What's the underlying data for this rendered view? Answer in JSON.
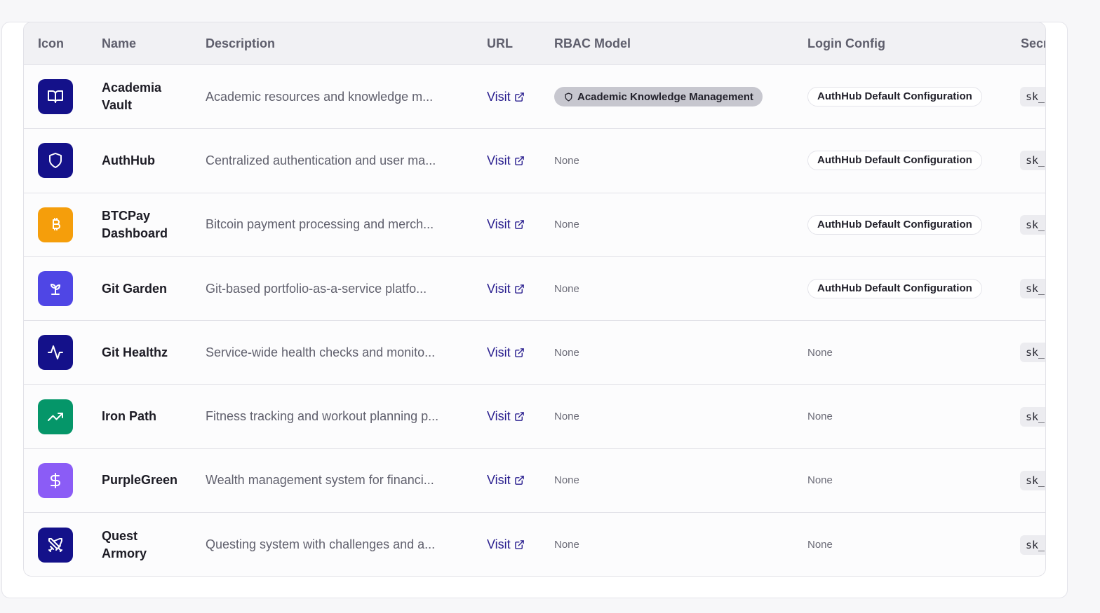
{
  "headers": {
    "icon": "Icon",
    "name": "Name",
    "description": "Description",
    "url": "URL",
    "rbac": "RBAC Model",
    "login": "Login Config",
    "secret": "Secr"
  },
  "rows": [
    {
      "icon": "book-open-icon",
      "color": "#14118a",
      "name": "Academia Vault",
      "description": "Academic resources and knowledge m...",
      "url_label": "Visit",
      "rbac": "Academic Knowledge Management",
      "login": "AuthHub Default Configuration",
      "secret": "sk_"
    },
    {
      "icon": "shield-icon",
      "color": "#14118a",
      "name": "AuthHub",
      "description": "Centralized authentication and user ma...",
      "url_label": "Visit",
      "rbac": "None",
      "login": "AuthHub Default Configuration",
      "secret": "sk_"
    },
    {
      "icon": "bitcoin-icon",
      "color": "#f59e0b",
      "name": "BTCPay Dashboard",
      "description": "Bitcoin payment processing and merch...",
      "url_label": "Visit",
      "rbac": "None",
      "login": "AuthHub Default Configuration",
      "secret": "sk_"
    },
    {
      "icon": "sprout-icon",
      "color": "#4f46e5",
      "name": "Git Garden",
      "description": "Git-based portfolio-as-a-service platfo...",
      "url_label": "Visit",
      "rbac": "None",
      "login": "AuthHub Default Configuration",
      "secret": "sk_"
    },
    {
      "icon": "activity-icon",
      "color": "#14118a",
      "name": "Git Healthz",
      "description": "Service-wide health checks and monito...",
      "url_label": "Visit",
      "rbac": "None",
      "login": "None",
      "secret": "sk_"
    },
    {
      "icon": "trending-up-icon",
      "color": "#059669",
      "name": "Iron Path",
      "description": "Fitness tracking and workout planning p...",
      "url_label": "Visit",
      "rbac": "None",
      "login": "None",
      "secret": "sk_"
    },
    {
      "icon": "dollar-sign-icon",
      "color": "#8b5cf6",
      "name": "PurpleGreen",
      "description": "Wealth management system for financi...",
      "url_label": "Visit",
      "rbac": "None",
      "login": "None",
      "secret": "sk_"
    },
    {
      "icon": "swords-icon",
      "color": "#14118a",
      "name": "Quest Armory",
      "description": "Questing system with challenges and a...",
      "url_label": "Visit",
      "rbac": "None",
      "login": "None",
      "secret": "sk_"
    }
  ]
}
